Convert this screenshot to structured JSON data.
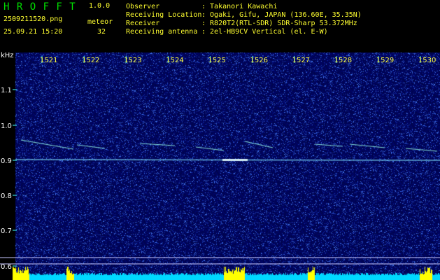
{
  "app": {
    "name": "H R O F F T",
    "version": "1.0.0"
  },
  "file": {
    "name": "2509211520.png",
    "datetime": "25.09.21 15:20"
  },
  "meteor": {
    "label": "meteor",
    "count": "32"
  },
  "info": [
    {
      "label": "Observer",
      "value": ": Takanori Kawachi"
    },
    {
      "label": "Receiving Location",
      "value": ": Ogaki, Gifu, JAPAN (136.60E, 35.35N)"
    },
    {
      "label": "Receiver",
      "value": ": R820T2(RTL-SDR) SDR-Sharp 53.372MHz"
    },
    {
      "label": "Receiving antenna",
      "value": ": 2el-HB9CV Vertical (el. E-W)"
    }
  ],
  "axis": {
    "unit": "kHz",
    "time_ticks": [
      "1521",
      "1522",
      "1523",
      "1524",
      "1525",
      "1526",
      "1527",
      "1528",
      "1529",
      "1530"
    ],
    "freq_ticks": [
      "1.1",
      "1.0",
      "0.9",
      "0.8",
      "0.7",
      "0.6"
    ]
  },
  "colors": {
    "header_green": "#00e000",
    "header_yellow": "#ffff30",
    "tick_cyan": "#40ffff",
    "spectrum_bg": "#000a5a",
    "bar_yellow": "#ffff00"
  }
}
